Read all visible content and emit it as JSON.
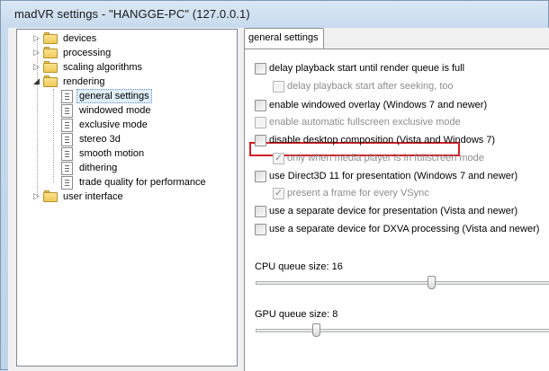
{
  "window": {
    "title": "madVR settings - \"HANGGE-PC\" (127.0.0.1)"
  },
  "tree": {
    "items": [
      {
        "label": "devices",
        "type": "folder",
        "expander": "▷"
      },
      {
        "label": "processing",
        "type": "folder",
        "expander": "▷"
      },
      {
        "label": "scaling algorithms",
        "type": "folder",
        "expander": "▷"
      },
      {
        "label": "rendering",
        "type": "folder",
        "expander": "◢"
      },
      {
        "label": "general settings",
        "type": "page",
        "selected": true
      },
      {
        "label": "windowed mode",
        "type": "page"
      },
      {
        "label": "exclusive mode",
        "type": "page"
      },
      {
        "label": "stereo 3d",
        "type": "page"
      },
      {
        "label": "smooth motion",
        "type": "page"
      },
      {
        "label": "dithering",
        "type": "page"
      },
      {
        "label": "trade quality for performance",
        "type": "page"
      },
      {
        "label": "user interface",
        "type": "folder",
        "expander": "▷"
      }
    ]
  },
  "tabs": {
    "active": "general settings"
  },
  "options": [
    {
      "label": "delay playback start until render queue is full",
      "checked": false,
      "enabled": true
    },
    {
      "label": "delay playback start after seeking, too",
      "checked": false,
      "enabled": false
    },
    {
      "label": "enable windowed overlay (Windows 7 and newer)",
      "checked": false,
      "enabled": true
    },
    {
      "label": "enable automatic fullscreen exclusive mode",
      "checked": false,
      "enabled": false,
      "highlighted": true
    },
    {
      "label": "disable desktop composition (Vista and Windows 7)",
      "checked": false,
      "enabled": true
    },
    {
      "label": "only when media player is in fullscreen mode",
      "checked": true,
      "enabled": false
    },
    {
      "label": "use Direct3D 11 for presentation (Windows 7 and newer)",
      "checked": false,
      "enabled": true
    },
    {
      "label": "present a frame for every VSync",
      "checked": true,
      "enabled": false
    },
    {
      "label": "use a separate device for presentation (Vista and newer)",
      "checked": false,
      "enabled": true
    },
    {
      "label": "use a separate device for DXVA processing (Vista and newer)",
      "checked": false,
      "enabled": true
    }
  ],
  "cpu_queue": {
    "label": "CPU queue size: 16",
    "value": 16
  },
  "gpu_queue": {
    "label": "GPU queue size: 8",
    "value": 8
  },
  "icons": {
    "checkmark": "✓"
  },
  "colors": {
    "highlight_border": "#d21f26",
    "selection_bg": "#dfeefb"
  }
}
